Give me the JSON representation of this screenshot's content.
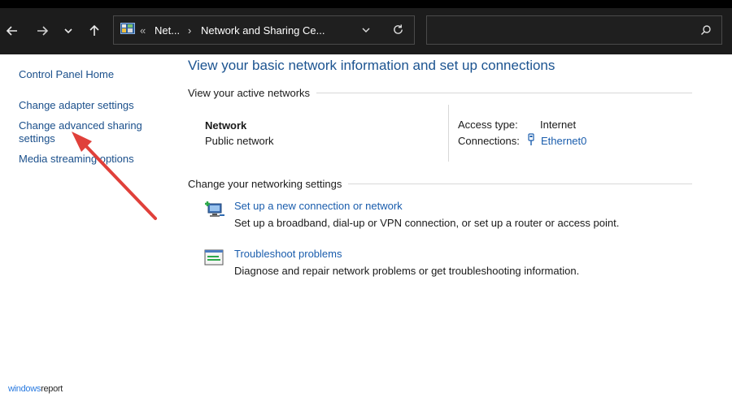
{
  "address": {
    "overflow": "«",
    "crumb1": "Net...",
    "separator": "›",
    "crumb2": "Network and Sharing Ce..."
  },
  "search": {
    "placeholder": ""
  },
  "sidebar": {
    "home": "Control Panel Home",
    "adapter": "Change adapter settings",
    "advanced_line1": "Change advanced sharing",
    "advanced_line2": "settings",
    "media": "Media streaming options"
  },
  "main": {
    "title": "View your basic network information and set up connections",
    "active_networks_heading": "View your active networks",
    "network_name": "Network",
    "network_type": "Public network",
    "access_type_label": "Access type:",
    "access_type_value": "Internet",
    "connections_label": "Connections:",
    "connections_value": "Ethernet0",
    "change_settings_heading": "Change your networking settings",
    "new_connection_title": "Set up a new connection or network",
    "new_connection_desc": "Set up a broadband, dial-up or VPN connection, or set up a router or access point.",
    "troubleshoot_title": "Troubleshoot problems",
    "troubleshoot_desc": "Diagnose and repair network problems or get troubleshooting information."
  },
  "watermark": {
    "brand": "windows",
    "suffix": "report"
  },
  "colors": {
    "toolbar_bg": "#1c1c1c",
    "link": "#1a5dad",
    "title": "#1b5390",
    "annotation_arrow": "#e0403a"
  },
  "icons": [
    "back-arrow-icon",
    "forward-arrow-icon",
    "history-chevron-icon",
    "up-arrow-icon",
    "control-panel-icon",
    "dropdown-chevron-icon",
    "refresh-icon",
    "search-icon",
    "ethernet-icon",
    "new-connection-icon",
    "troubleshoot-icon"
  ]
}
